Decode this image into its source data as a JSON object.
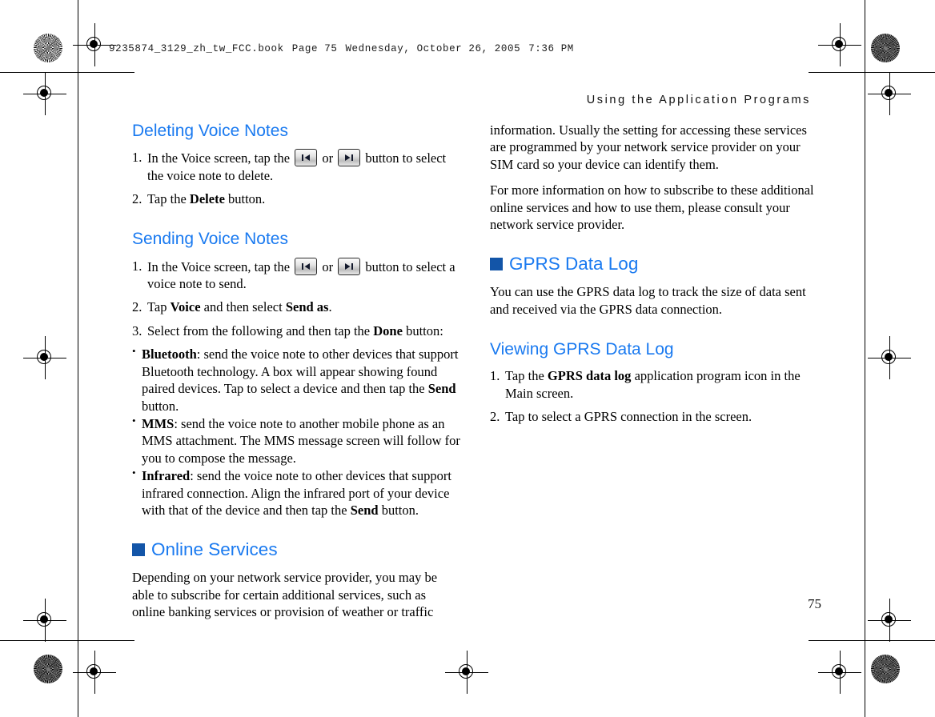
{
  "printer_slug": {
    "filename": "9235874_3129_zh_tw_FCC.book",
    "page_label": "Page 75",
    "weekday": "Wednesday,",
    "date": "October 26, 2005",
    "time": "7:36 PM"
  },
  "running_head": "Using the Application Programs",
  "folio": "75",
  "colors": {
    "heading_blue": "#1a7af0",
    "marker_blue": "#1355a8",
    "body_black": "#000000"
  },
  "icons": {
    "previous_track": "previous-track-icon",
    "next_track": "next-track-icon"
  },
  "left_column": {
    "heading_deleting": "Deleting Voice Notes",
    "deleting_steps": [
      {
        "pre": "In the Voice screen, tap the",
        "mid": "or",
        "post": "button to select the voice note to delete."
      },
      {
        "pre": "Tap the",
        "bold": "Delete",
        "post": "button."
      }
    ],
    "heading_sending": "Sending Voice Notes",
    "sending_step_1": {
      "pre": "In the Voice screen, tap the",
      "mid": "or",
      "post": "button to select a voice note to send."
    },
    "sending_step_2": {
      "pre": "Tap",
      "bold1": "Voice",
      "mid": "and then select",
      "bold2": "Send as",
      "post": "."
    },
    "sending_step_3": {
      "pre": "Select from the following and then tap the",
      "bold": "Done",
      "post": "button:"
    },
    "send_options": [
      {
        "label": "Bluetooth",
        "text_1": ": send the voice note to other devices that support Bluetooth technology. A box will appear showing found paired devices. Tap to select a device and then tap the",
        "bold_inline": "Send",
        "text_2": "button."
      },
      {
        "label": "MMS",
        "text_1": ": send the voice note to another mobile phone as an MMS attachment. The MMS message screen will follow for you to compose the message.",
        "bold_inline": "",
        "text_2": ""
      },
      {
        "label": "Infrared",
        "text_1": ": send the voice note to other devices that support infrared connection. Align the infrared port of your device with that of the device and then tap the",
        "bold_inline": "Send",
        "text_2": "button."
      }
    ],
    "heading_online_services": "Online Services",
    "online_services_para": "Depending on your network service provider, you may be able to subscribe for certain additional services, such as online banking services or provision of weather or traffic"
  },
  "right_column": {
    "continued_para": "information. Usually the setting for accessing these services are programmed by your network service provider on your SIM card so your device can identify them.",
    "more_info_para": "For more information on how to subscribe to these additional online services and how to use them, please consult your network service provider.",
    "heading_gprs": "GPRS Data Log",
    "gprs_para": "You can use the GPRS data log to track the size of data sent and received via the GPRS data connection.",
    "heading_viewing": "Viewing GPRS Data Log",
    "viewing_steps": [
      {
        "pre": "Tap the",
        "bold": "GPRS data log",
        "post": "application program icon in the Main screen."
      },
      {
        "pre": "Tap to select a GPRS connection in the screen.",
        "bold": "",
        "post": ""
      }
    ]
  }
}
